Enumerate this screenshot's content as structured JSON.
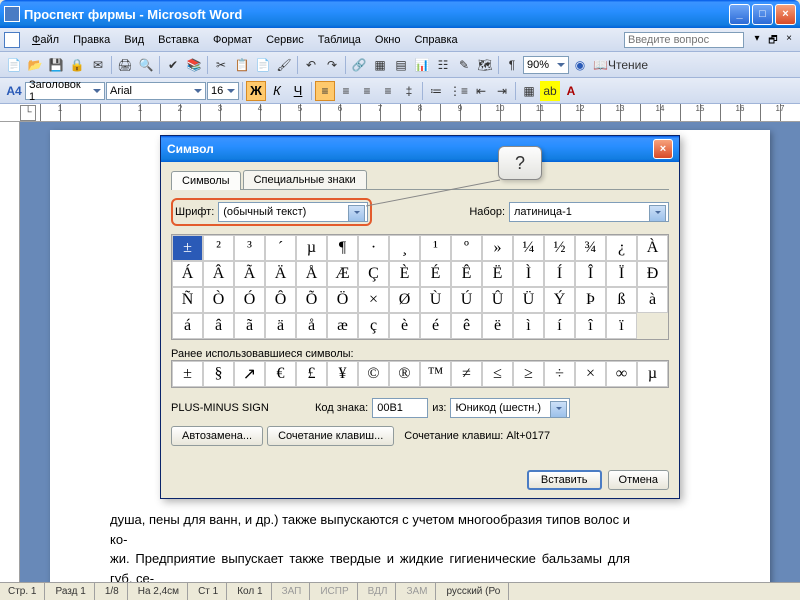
{
  "titlebar": {
    "title": "Проспект фирмы - Microsoft Word"
  },
  "menu": {
    "file": "Файл",
    "edit": "Правка",
    "view": "Вид",
    "insert": "Вставка",
    "format": "Формат",
    "service": "Сервис",
    "table": "Таблица",
    "window": "Окно",
    "help": "Справка",
    "ask_placeholder": "Введите вопрос"
  },
  "toolbar1": {
    "zoom": "90%",
    "reading": "Чтение"
  },
  "toolbar2": {
    "style_label": "A4",
    "style": "Заголовок 1",
    "font": "Arial",
    "size": "16",
    "bold": "Ж",
    "italic": "К",
    "underline": "Ч"
  },
  "ruler": {
    "marks": [
      "1",
      "",
      "1",
      "2",
      "3",
      "4",
      "5",
      "6",
      "7",
      "8",
      "9",
      "10",
      "11",
      "12",
      "13",
      "14",
      "15",
      "16",
      "17"
    ]
  },
  "doc": {
    "para1": "душа, пены для ванн, и др.) также выпускаются с учетом многообразия типов волос и ко-",
    "para2": "жи. Предприятие выпускает также твердые и жидкие гигиенические бальзамы для губ, се-"
  },
  "dialog": {
    "title": "Символ",
    "tab_symbols": "Символы",
    "tab_special": "Специальные знаки",
    "font_label": "Шрифт:",
    "font_value": "(обычный текст)",
    "set_label": "Набор:",
    "set_value": "латиница-1",
    "grid": [
      "±",
      "²",
      "³",
      "´",
      "µ",
      "¶",
      "·",
      "¸",
      "¹",
      "º",
      "»",
      "¼",
      "½",
      "¾",
      "¿",
      "À",
      "Á",
      "Â",
      "Ã",
      "Ä",
      "Å",
      "Æ",
      "Ç",
      "È",
      "É",
      "Ê",
      "Ë",
      "Ì",
      "Í",
      "Î",
      "Ï",
      "Ð",
      "Ñ",
      "Ò",
      "Ó",
      "Ô",
      "Õ",
      "Ö",
      "×",
      "Ø",
      "Ù",
      "Ú",
      "Û",
      "Ü",
      "Ý",
      "Þ",
      "ß",
      "à",
      "á",
      "â",
      "ã",
      "ä",
      "å",
      "æ",
      "ç",
      "è",
      "é",
      "ê",
      "ë",
      "ì",
      "í",
      "î",
      "ï"
    ],
    "recent_label": "Ранее использовавшиеся символы:",
    "recent": [
      "±",
      "§",
      "↗",
      "€",
      "£",
      "¥",
      "©",
      "®",
      "™",
      "≠",
      "≤",
      "≥",
      "÷",
      "×",
      "∞",
      "µ"
    ],
    "charname": "PLUS-MINUS SIGN",
    "code_label": "Код знака:",
    "code_value": "00B1",
    "from_label": "из:",
    "from_value": "Юникод (шестн.)",
    "autocorrect": "Автозамена...",
    "shortcut_btn": "Сочетание клавиш...",
    "shortcut_label": "Сочетание клавиш: Alt+0177",
    "insert": "Вставить",
    "cancel": "Отмена"
  },
  "callout": {
    "text": "?"
  },
  "status": {
    "page": "Стр. 1",
    "section": "Разд 1",
    "pages": "1/8",
    "at": "На 2,4см",
    "line": "Ст 1",
    "col": "Кол 1",
    "rec": "ЗАП",
    "trk": "ИСПР",
    "ext": "ВДЛ",
    "ovr": "ЗАМ",
    "lang": "русский (Ро"
  }
}
